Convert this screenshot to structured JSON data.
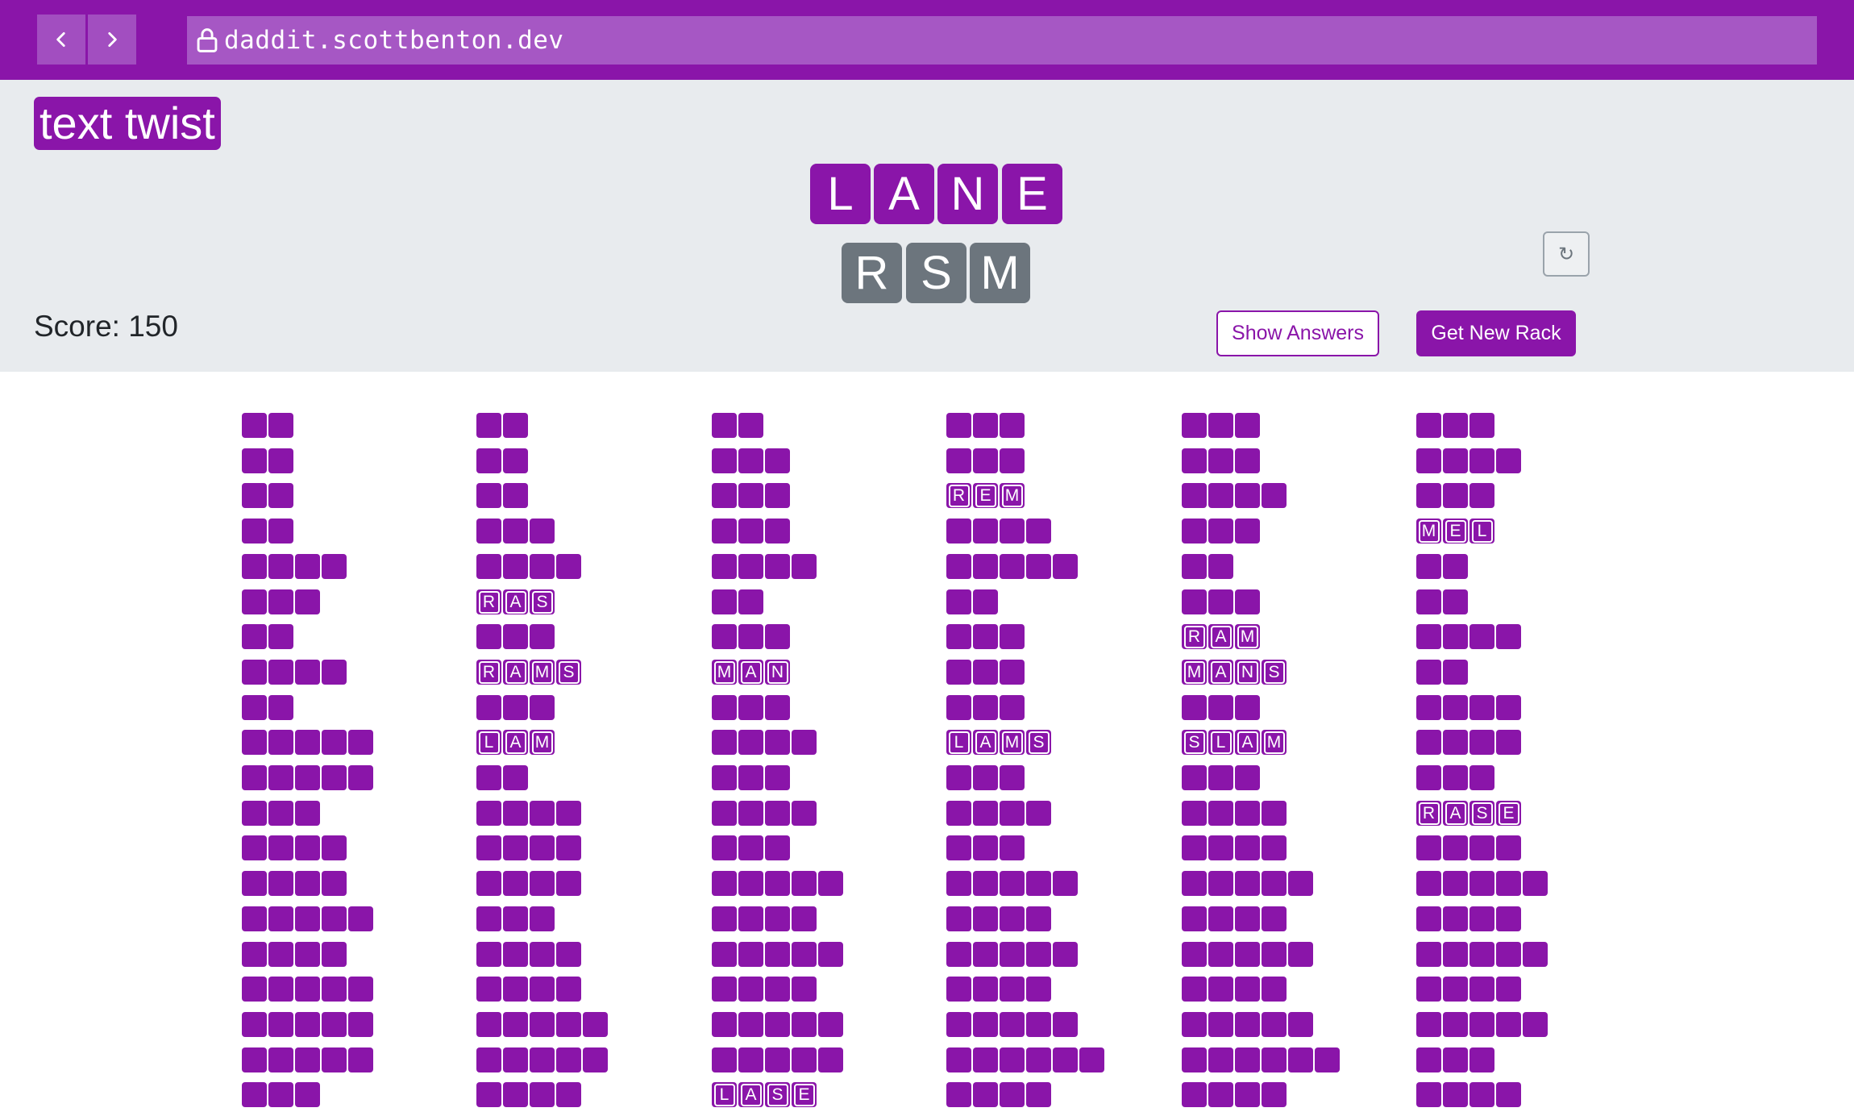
{
  "browser": {
    "back_icon": "chevron-left-icon",
    "forward_icon": "chevron-right-icon",
    "lock_icon": "lock-icon",
    "url": "daddit.scottbenton.dev"
  },
  "app": {
    "title": "text twist",
    "score_label": "Score: 150",
    "shuffle_label": "↻",
    "show_answers_label": "Show Answers",
    "new_rack_label": "Get New Rack"
  },
  "rack": {
    "used_letters": [
      "L",
      "A",
      "N",
      "E"
    ],
    "remaining_letters": [
      "R",
      "S",
      "M"
    ]
  },
  "colors": {
    "accent": "#8a15a9",
    "chrome": "#8a15a9",
    "url_bar": "#a657c4",
    "header_bg": "#e8ebee",
    "unused_tile": "#6c757d"
  },
  "word_columns": [
    [
      {
        "length": 2
      },
      {
        "length": 2
      },
      {
        "length": 2
      },
      {
        "length": 2
      },
      {
        "length": 4
      },
      {
        "length": 3
      },
      {
        "length": 2
      },
      {
        "length": 4
      },
      {
        "length": 2
      },
      {
        "length": 5
      },
      {
        "length": 5
      },
      {
        "length": 3
      },
      {
        "length": 4
      },
      {
        "length": 4
      },
      {
        "length": 5
      },
      {
        "length": 4
      },
      {
        "length": 5
      },
      {
        "length": 5
      },
      {
        "length": 5
      },
      {
        "length": 3
      }
    ],
    [
      {
        "length": 2
      },
      {
        "length": 2
      },
      {
        "length": 2
      },
      {
        "length": 3
      },
      {
        "length": 4
      },
      {
        "word": "RAS"
      },
      {
        "length": 3
      },
      {
        "word": "RAMS"
      },
      {
        "length": 3
      },
      {
        "word": "LAM"
      },
      {
        "length": 2
      },
      {
        "length": 4
      },
      {
        "length": 4
      },
      {
        "length": 4
      },
      {
        "length": 3
      },
      {
        "length": 4
      },
      {
        "length": 4
      },
      {
        "length": 5
      },
      {
        "length": 5
      },
      {
        "length": 4
      }
    ],
    [
      {
        "length": 2
      },
      {
        "length": 3
      },
      {
        "length": 3
      },
      {
        "length": 3
      },
      {
        "length": 4
      },
      {
        "length": 2
      },
      {
        "length": 3
      },
      {
        "word": "MAN"
      },
      {
        "length": 3
      },
      {
        "length": 4
      },
      {
        "length": 3
      },
      {
        "length": 4
      },
      {
        "length": 3
      },
      {
        "length": 5
      },
      {
        "length": 4
      },
      {
        "length": 5
      },
      {
        "length": 4
      },
      {
        "length": 5
      },
      {
        "length": 5
      },
      {
        "word": "LASE"
      }
    ],
    [
      {
        "length": 3
      },
      {
        "length": 3
      },
      {
        "word": "REM"
      },
      {
        "length": 4
      },
      {
        "length": 5
      },
      {
        "length": 2
      },
      {
        "length": 3
      },
      {
        "length": 3
      },
      {
        "length": 3
      },
      {
        "word": "LAMS"
      },
      {
        "length": 3
      },
      {
        "length": 4
      },
      {
        "length": 3
      },
      {
        "length": 5
      },
      {
        "length": 4
      },
      {
        "length": 5
      },
      {
        "length": 4
      },
      {
        "length": 5
      },
      {
        "length": 6
      },
      {
        "length": 4
      }
    ],
    [
      {
        "length": 3
      },
      {
        "length": 3
      },
      {
        "length": 4
      },
      {
        "length": 3
      },
      {
        "length": 2
      },
      {
        "length": 3
      },
      {
        "word": "RAM"
      },
      {
        "word": "MANS"
      },
      {
        "length": 3
      },
      {
        "word": "SLAM"
      },
      {
        "length": 3
      },
      {
        "length": 4
      },
      {
        "length": 4
      },
      {
        "length": 5
      },
      {
        "length": 4
      },
      {
        "length": 5
      },
      {
        "length": 4
      },
      {
        "length": 5
      },
      {
        "length": 6
      },
      {
        "length": 4
      }
    ],
    [
      {
        "length": 3
      },
      {
        "length": 4
      },
      {
        "length": 3
      },
      {
        "word": "MEL"
      },
      {
        "length": 2
      },
      {
        "length": 2
      },
      {
        "length": 4
      },
      {
        "length": 2
      },
      {
        "length": 4
      },
      {
        "length": 4
      },
      {
        "length": 3
      },
      {
        "word": "RASE"
      },
      {
        "length": 4
      },
      {
        "length": 5
      },
      {
        "length": 4
      },
      {
        "length": 5
      },
      {
        "length": 4
      },
      {
        "length": 5
      },
      {
        "length": 3
      },
      {
        "length": 4
      }
    ]
  ]
}
